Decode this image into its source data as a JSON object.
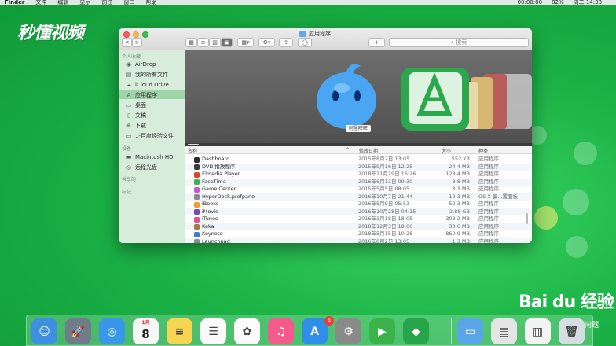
{
  "menubar": {
    "items": [
      "Finder",
      "文件",
      "编辑",
      "显示",
      "前往",
      "窗口",
      "帮助"
    ],
    "clock": "00:00:00",
    "battery": "82%",
    "datetime": "周二 14:38"
  },
  "watermark": {
    "logo": "秒懂视频"
  },
  "window": {
    "title": "应用程序",
    "search_placeholder": "搜索",
    "back_label": "<",
    "forward_label": ">",
    "add_label": "+"
  },
  "sidebar": {
    "favorites_header": "个人收藏",
    "favorites": [
      {
        "label": "AirDrop",
        "icon": "airdrop-icon"
      },
      {
        "label": "我的所有文件",
        "icon": "all-files-icon"
      },
      {
        "label": "iCloud Drive",
        "icon": "cloud-icon"
      },
      {
        "label": "应用程序",
        "icon": "applications-icon",
        "selected": true
      },
      {
        "label": "桌面",
        "icon": "desktop-icon"
      },
      {
        "label": "文稿",
        "icon": "documents-icon"
      },
      {
        "label": "下载",
        "icon": "download-icon"
      },
      {
        "label": "1-百度经验文件",
        "icon": "folder-icon"
      }
    ],
    "devices_header": "设备",
    "devices": [
      {
        "label": "Macintosh HD",
        "icon": "disk-icon"
      },
      {
        "label": "远程光盘",
        "icon": "remote-disc-icon"
      }
    ],
    "shared_header": "共享的",
    "tags_header": "标记"
  },
  "coverflow": {
    "caption": "阿里旺旺"
  },
  "columns": {
    "name": "名称",
    "date": "修改日期",
    "size": "大小",
    "kind": "种类"
  },
  "rows": [
    {
      "name": "Dashboard",
      "date": "2015年8月2日 13:05",
      "size": "552 KB",
      "kind": "应用程序",
      "color": "#2b2b2b"
    },
    {
      "name": "DVD 播放程序",
      "date": "2015年9月16日 12:25",
      "size": "24.4 MB",
      "kind": "应用程序",
      "color": "#3a3a3a"
    },
    {
      "name": "Elmedia Player",
      "date": "2018年11月29日 16:26",
      "size": "128.4 MB",
      "kind": "应用程序",
      "color": "#d9442c"
    },
    {
      "name": "FaceTime",
      "date": "2016年6月13日 09:30",
      "size": "8.8 MB",
      "kind": "应用程序",
      "color": "#3cb34a"
    },
    {
      "name": "Game Center",
      "date": "2015年5月5日 08:05",
      "size": "3.3 MB",
      "kind": "应用程序",
      "color": "#c45ad0"
    },
    {
      "name": "HyperDock.prefpane",
      "date": "2016年10月7日 21:44",
      "size": "12.3 MB",
      "kind": "OS X 偏...置面板",
      "color": "#8a8a8a"
    },
    {
      "name": "iBooks",
      "date": "2016年5月9日 05:53",
      "size": "52.3 MB",
      "kind": "应用程序",
      "color": "#f29a2e"
    },
    {
      "name": "iMovie",
      "date": "2016年10月28日 04:15",
      "size": "2.88 GB",
      "kind": "应用程序",
      "color": "#6a4fb0"
    },
    {
      "name": "iTunes",
      "date": "2016年3月18日 18:05",
      "size": "303.2 MB",
      "kind": "应用程序",
      "color": "#e84f8a"
    },
    {
      "name": "Keka",
      "date": "2018年12月3日 18:06",
      "size": "30.6 MB",
      "kind": "应用程序",
      "color": "#a5773f"
    },
    {
      "name": "Keynote",
      "date": "2018年5月15日 10:28",
      "size": "860.9 MB",
      "kind": "应用程序",
      "color": "#3d7bd9"
    },
    {
      "name": "Launchpad",
      "date": "2016年8月2日 13:05",
      "size": "1.3 MB",
      "kind": "应用程序",
      "color": "#8c8c8c"
    }
  ],
  "desktop": {
    "baidu_logo": "Bai du 经验",
    "baidu_sub": "问题"
  },
  "dock": {
    "apps": [
      {
        "name": "finder-icon",
        "color": "#3d8fe0",
        "glyph": "☺"
      },
      {
        "name": "launchpad-icon",
        "color": "#6f7c8a",
        "glyph": "🚀"
      },
      {
        "name": "safari-icon",
        "color": "#3897e8",
        "glyph": "◎"
      },
      {
        "name": "calendar-icon",
        "color": "#f6f6f6",
        "glyph": "8"
      },
      {
        "name": "notes-icon",
        "color": "#f5d552",
        "glyph": "≡"
      },
      {
        "name": "reminders-icon",
        "color": "#fafafa",
        "glyph": "☰"
      },
      {
        "name": "photos-icon",
        "color": "#fbfbfb",
        "glyph": "✿"
      },
      {
        "name": "itunes-icon",
        "color": "#f55a8c",
        "glyph": "♫"
      },
      {
        "name": "app-store-icon",
        "color": "#2f8ee8",
        "glyph": "A"
      },
      {
        "name": "system-preferences-icon",
        "color": "#8a8a8a",
        "glyph": "⚙"
      },
      {
        "name": "facetime-icon",
        "color": "#3ab44a",
        "glyph": "▶"
      },
      {
        "name": "coverflow-app-icon",
        "color": "#27a548",
        "glyph": "◆"
      },
      {
        "name": "applications-folder-icon",
        "color": "#5aa5e8",
        "glyph": "▭"
      },
      {
        "name": "preview-stack-icon",
        "color": "#e5e5e5",
        "glyph": "▤"
      },
      {
        "name": "document-stack-icon",
        "color": "#f4f4f4",
        "glyph": "▥"
      },
      {
        "name": "trash-icon",
        "color": "#d6dde2",
        "glyph": "🗑"
      }
    ],
    "calendar_month": "1月",
    "calendar_day": "8",
    "app_store_badge": "4"
  }
}
